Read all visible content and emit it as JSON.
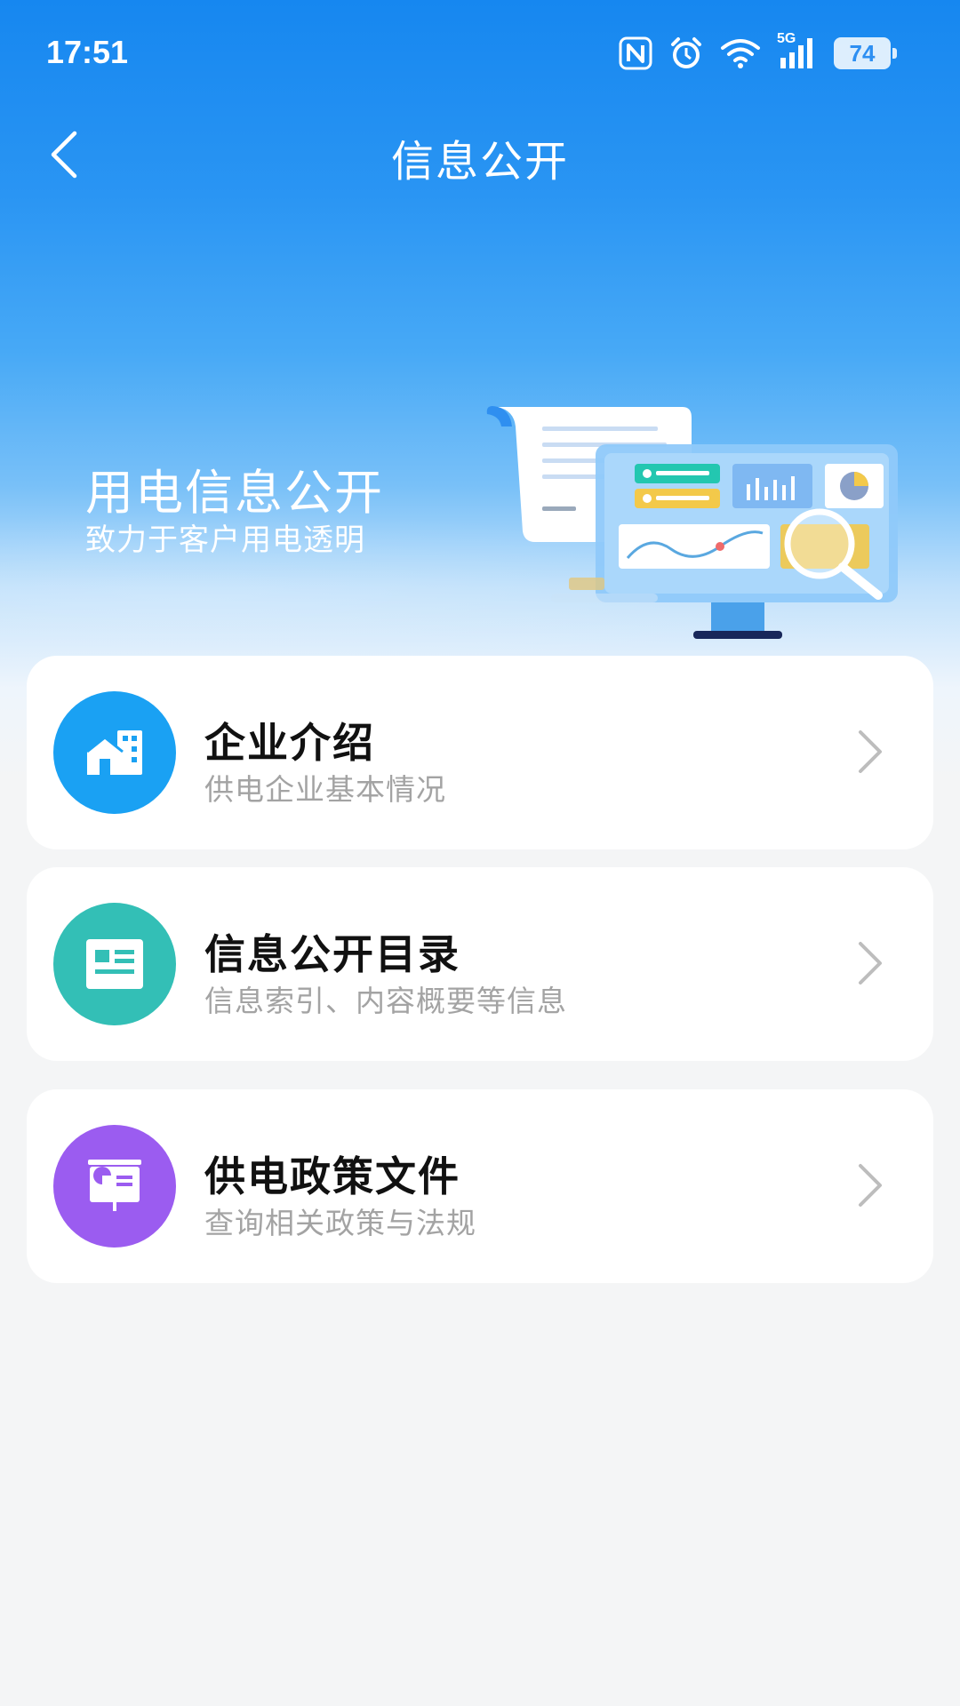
{
  "status_bar": {
    "time": "17:51",
    "network": "5G",
    "battery": "74",
    "icons": [
      "nfc-icon",
      "alarm-icon",
      "wifi-icon",
      "signal-5g-icon",
      "battery-icon"
    ]
  },
  "nav": {
    "title": "信息公开",
    "back_icon": "back-chevron-icon"
  },
  "hero": {
    "title": "用电信息公开",
    "subtitle": "致力于客户用电透明",
    "illustration": "document-monitor-magnifier-illustration"
  },
  "menu": [
    {
      "title": "企业介绍",
      "desc": "供电企业基本情况",
      "icon": "building-icon",
      "color": "#1aa1f3"
    },
    {
      "title": "信息公开目录",
      "desc": "信息索引、内容概要等信息",
      "icon": "catalog-icon",
      "color": "#33bfb6"
    },
    {
      "title": "供电政策文件",
      "desc": "查询相关政策与法规",
      "icon": "policy-board-icon",
      "color": "#9b5cf0"
    }
  ],
  "colors": {
    "header_blue": "#1687f0",
    "background": "#f4f5f6",
    "title_text": "#111111",
    "desc_text": "#a3a3a3"
  }
}
